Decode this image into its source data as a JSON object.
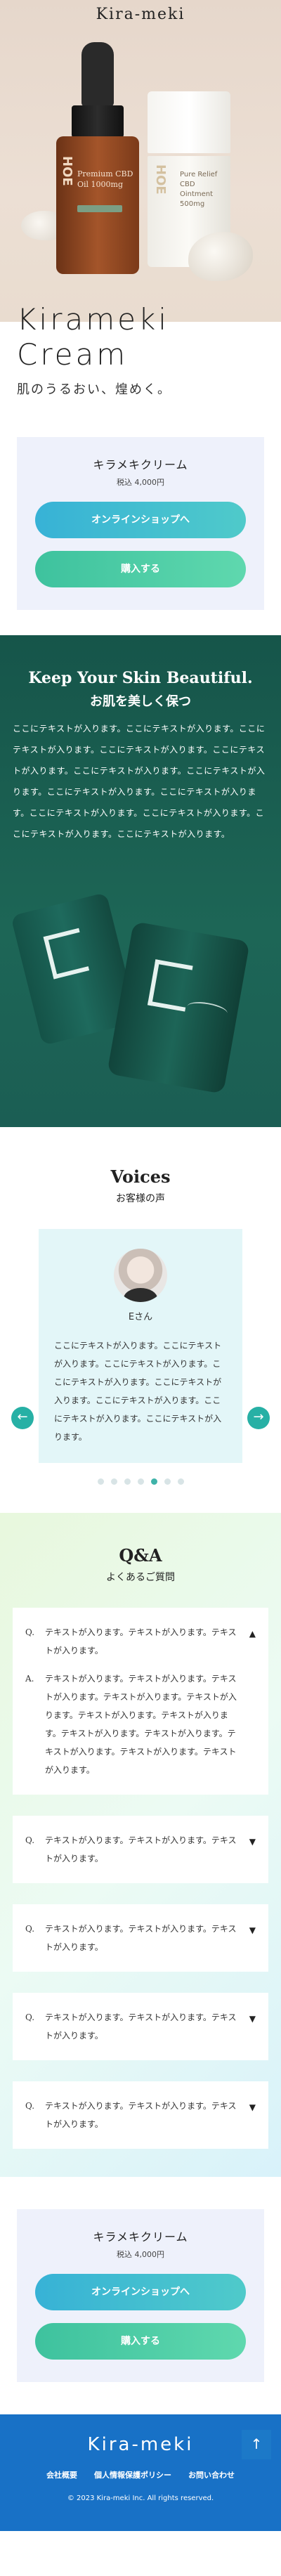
{
  "header": {
    "brand": "Kira-meki"
  },
  "hero": {
    "title_line1": "Kirameki",
    "title_line2": "Cream",
    "subtitle": "肌のうるおい、煌めく。",
    "bottle_label": "Premium CBD Oil 1000mg",
    "bottle_vertical": "HOE",
    "jar_label": "Pure Relief CBD Ointment 500mg",
    "jar_vertical": "HOE"
  },
  "buy_box": {
    "product_name": "キラメキクリーム",
    "price": "税込 4,000円",
    "shop_button": "オンラインショップへ",
    "buy_button": "購入する"
  },
  "keep": {
    "title": "Keep Your Skin Beautiful.",
    "subtitle": "お肌を美しく保つ",
    "body": "ここにテキストが入ります。ここにテキストが入ります。ここにテキストが入ります。ここにテキストが入ります。ここにテキストが入ります。ここにテキストが入ります。ここにテキストが入ります。ここにテキストが入ります。ここにテキストが入ります。ここにテキストが入ります。ここにテキストが入ります。ここにテキストが入ります。ここにテキストが入ります。"
  },
  "voices": {
    "title": "Voices",
    "subtitle": "お客様の声",
    "name": "Eさん",
    "text": "ここにテキストが入ります。ここにテキストが入ります。ここにテキストが入ります。ここにテキストが入ります。ここにテキストが入ります。ここにテキストが入ります。ここにテキストが入ります。ここにテキストが入ります。",
    "prev_arrow": "←",
    "next_arrow": "→"
  },
  "qa": {
    "title": "Q&A",
    "subtitle": "よくあるご質問",
    "q_mark": "Q.",
    "a_mark": "A.",
    "items": [
      {
        "question": "テキストが入ります。テキストが入ります。テキストが入ります。",
        "toggle": "▲",
        "answer": "テキストが入ります。テキストが入ります。テキストが入ります。テキストが入ります。テキストが入ります。テキストが入ります。テキストが入ります。テキストが入ります。テキストが入ります。テキストが入ります。テキストが入ります。テキストが入ります。"
      },
      {
        "question": "テキストが入ります。テキストが入ります。テキストが入ります。",
        "toggle": "▼"
      },
      {
        "question": "テキストが入ります。テキストが入ります。テキストが入ります。",
        "toggle": "▼"
      },
      {
        "question": "テキストが入ります。テキストが入ります。テキストが入ります。",
        "toggle": "▼"
      },
      {
        "question": "テキストが入ります。テキストが入ります。テキストが入ります。",
        "toggle": "▼"
      }
    ]
  },
  "page_top": "↑",
  "footer": {
    "logo": "Kira-meki",
    "nav": [
      "会社概要",
      "個人情報保護ポリシー",
      "お問い合わせ"
    ],
    "copyright": "© 2023 Kira-meki Inc. All rights reserved."
  },
  "colors": {
    "accent_blue": "#1871c6",
    "accent_green": "#1d6656",
    "shop_button": "#37b2d6",
    "buy_button": "#3ec29e"
  }
}
